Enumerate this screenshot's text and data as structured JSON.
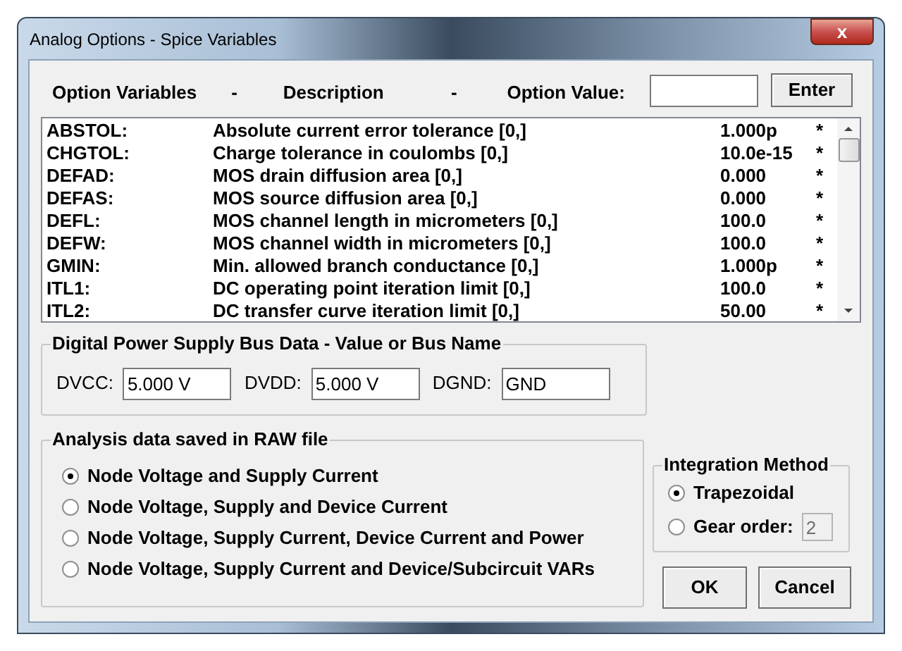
{
  "window": {
    "title": "Analog Options - Spice Variables",
    "close": "x"
  },
  "header": {
    "labels": [
      "Option Variables",
      "-",
      "Description",
      "-",
      "Option Value:"
    ],
    "enter_button": "Enter"
  },
  "variables": [
    {
      "name": "ABSTOL:",
      "description": "Absolute current error tolerance [0,]",
      "value": "1.000p",
      "flag": "*"
    },
    {
      "name": "CHGTOL:",
      "description": "Charge tolerance in coulombs [0,]",
      "value": "10.0e-15",
      "flag": "*"
    },
    {
      "name": "DEFAD:",
      "description": "MOS drain diffusion area [0,]",
      "value": "0.000",
      "flag": "*"
    },
    {
      "name": "DEFAS:",
      "description": "MOS source diffusion area [0,]",
      "value": "0.000",
      "flag": "*"
    },
    {
      "name": "DEFL:",
      "description": "MOS channel length in micrometers [0,]",
      "value": "100.0",
      "flag": "*"
    },
    {
      "name": "DEFW:",
      "description": "MOS channel width in micrometers [0,]",
      "value": "100.0",
      "flag": "*"
    },
    {
      "name": "GMIN:",
      "description": "Min. allowed branch conductance [0,]",
      "value": "1.000p",
      "flag": "*"
    },
    {
      "name": "ITL1:",
      "description": "DC operating point iteration limit [0,]",
      "value": "100.0",
      "flag": "*"
    },
    {
      "name": "ITL2:",
      "description": "DC transfer curve iteration limit [0,]",
      "value": "50.00",
      "flag": "*"
    }
  ],
  "digital_power": {
    "title": "Digital Power Supply Bus Data - Value or Bus Name",
    "fields": [
      {
        "label": "DVCC:",
        "value": "5.000 V"
      },
      {
        "label": "DVDD:",
        "value": "5.000 V"
      },
      {
        "label": "DGND:",
        "value": "GND"
      }
    ]
  },
  "raw_file": {
    "title": "Analysis data saved in RAW file",
    "options": [
      {
        "label": "Node Voltage and Supply Current",
        "selected": true
      },
      {
        "label": "Node Voltage, Supply and Device Current",
        "selected": false
      },
      {
        "label": "Node Voltage, Supply Current, Device Current and Power",
        "selected": false
      },
      {
        "label": "Node Voltage, Supply Current and Device/Subcircuit VARs",
        "selected": false
      }
    ]
  },
  "integration": {
    "title": "Integration Method",
    "options": [
      {
        "label": "Trapezoidal",
        "selected": true
      },
      {
        "label": "Gear order:",
        "selected": false,
        "field": {
          "value": "2",
          "disabled": true
        }
      }
    ]
  },
  "buttons": [
    "OK",
    "Cancel"
  ]
}
